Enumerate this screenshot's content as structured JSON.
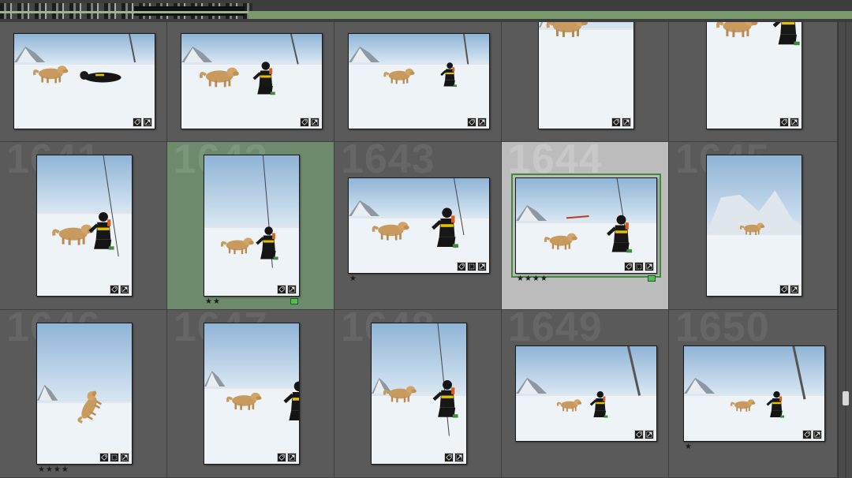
{
  "grid": {
    "cells": [
      {
        "index": "",
        "stars": "",
        "flag": false,
        "state": "normal",
        "orient": "land",
        "scene": "lying",
        "badges": [
          "tag-icon",
          "crop-icon"
        ]
      },
      {
        "index": "",
        "stars": "",
        "flag": false,
        "state": "normal",
        "orient": "land",
        "scene": "kneel",
        "badges": [
          "tag-icon",
          "crop-icon"
        ]
      },
      {
        "index": "",
        "stars": "",
        "flag": false,
        "state": "normal",
        "orient": "land",
        "scene": "kneel-small",
        "badges": [
          "tag-icon",
          "crop-icon"
        ]
      },
      {
        "index": "",
        "stars": "",
        "flag": false,
        "state": "normal",
        "orient": "port",
        "scene": "dog-only",
        "badges": [
          "tag-icon",
          "crop-icon"
        ]
      },
      {
        "index": "",
        "stars": "",
        "flag": false,
        "state": "normal",
        "orient": "port",
        "scene": "dog-man-right",
        "badges": [
          "tag-icon",
          "crop-icon"
        ]
      },
      {
        "index": "1641",
        "stars": "",
        "flag": false,
        "state": "normal",
        "orient": "port",
        "scene": "hug",
        "badges": [
          "tag-icon",
          "crop-icon"
        ]
      },
      {
        "index": "1642",
        "stars": "★★",
        "flag": true,
        "state": "selected",
        "orient": "port",
        "scene": "kneel-face",
        "badges": [
          "tag-icon",
          "crop-icon"
        ]
      },
      {
        "index": "1643",
        "stars": "★",
        "flag": false,
        "state": "normal",
        "orient": "land",
        "scene": "tug",
        "badges": [
          "tag-icon",
          "frame-icon",
          "crop-icon"
        ]
      },
      {
        "index": "1644",
        "stars": "★★★★",
        "flag": true,
        "state": "active",
        "orient": "land",
        "scene": "throw",
        "badges": [
          "tag-icon",
          "frame-icon",
          "crop-icon"
        ]
      },
      {
        "index": "1645",
        "stars": "",
        "flag": false,
        "state": "normal",
        "orient": "port",
        "scene": "dog-mountain",
        "badges": [
          "tag-icon",
          "crop-icon"
        ]
      },
      {
        "index": "1646",
        "stars": "★★★★",
        "flag": false,
        "state": "normal",
        "orient": "port",
        "scene": "dog-jump",
        "badges": [
          "tag-icon",
          "frame-icon",
          "crop-icon"
        ]
      },
      {
        "index": "1647",
        "stars": "",
        "flag": false,
        "state": "normal",
        "orient": "port",
        "scene": "dog-sniff",
        "badges": [
          "tag-icon",
          "crop-icon"
        ]
      },
      {
        "index": "1648",
        "stars": "",
        "flag": false,
        "state": "normal",
        "orient": "port",
        "scene": "man-camera",
        "badges": [
          "tag-icon",
          "crop-icon"
        ]
      },
      {
        "index": "1649",
        "stars": "",
        "flag": false,
        "state": "normal",
        "orient": "land",
        "scene": "wide-kneel",
        "badges": [
          "tag-icon",
          "crop-icon"
        ]
      },
      {
        "index": "1650",
        "stars": "★",
        "flag": false,
        "state": "normal",
        "orient": "land",
        "scene": "wide-kneel2",
        "badges": [
          "tag-icon",
          "crop-icon"
        ]
      }
    ]
  },
  "colors": {
    "cell_bg": "#5a5a5a",
    "selected_bg": "#6e8a6c",
    "active_bg": "#bcbcbc",
    "flag_green": "#4fbf4f"
  }
}
